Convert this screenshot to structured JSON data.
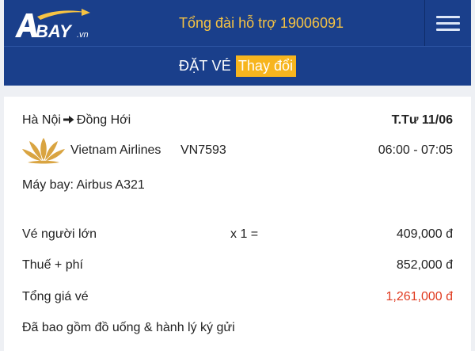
{
  "header": {
    "logo_text": "BAY",
    "logo_suffix": ".vn",
    "hotline": "Tổng đài hỗ trợ 19006091"
  },
  "subbar": {
    "title": "ĐẶT VÉ",
    "change_label": "Thay đổi"
  },
  "flight": {
    "origin": "Hà Nội",
    "destination": "Đồng Hới",
    "date": "T.Tư  11/06",
    "airline": "Vietnam Airlines",
    "flight_no": "VN7593",
    "time": "06:00 - 07:05",
    "aircraft": "Máy bay: Airbus A321"
  },
  "fare": {
    "adult_label": "Vé người lớn",
    "adult_qty": "x 1 =",
    "adult_price": "409,000 đ",
    "tax_label": "Thuế + phí",
    "tax_price": "852,000 đ",
    "total_label": "Tổng giá vé",
    "total_price": "1,261,000 đ",
    "note": "Đã bao gồm đồ uống & hành lý ký gửi"
  },
  "colors": {
    "header_bg": "#1a3f8b",
    "hotline": "#f6c343",
    "change_button": "#f7b51e",
    "total_price": "#e03a1f",
    "airline_logo": "#d9a441"
  },
  "icons": [
    "abay-logo",
    "menu-icon",
    "arrow-right-icon",
    "vietnam-airlines-lotus-logo"
  ]
}
